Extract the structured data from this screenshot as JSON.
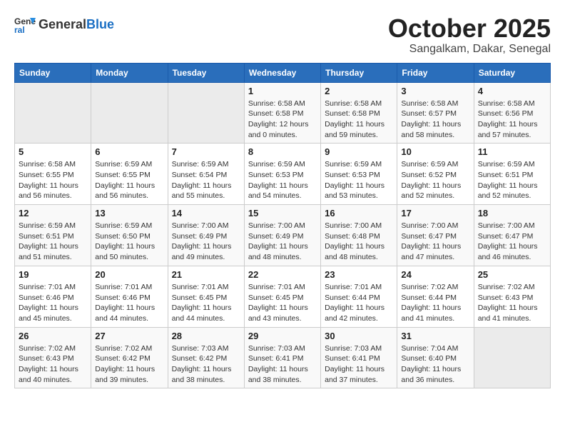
{
  "header": {
    "logo_line1": "General",
    "logo_line2": "Blue",
    "month": "October 2025",
    "location": "Sangalkam, Dakar, Senegal"
  },
  "weekdays": [
    "Sunday",
    "Monday",
    "Tuesday",
    "Wednesday",
    "Thursday",
    "Friday",
    "Saturday"
  ],
  "weeks": [
    [
      {
        "day": "",
        "info": ""
      },
      {
        "day": "",
        "info": ""
      },
      {
        "day": "",
        "info": ""
      },
      {
        "day": "1",
        "info": "Sunrise: 6:58 AM\nSunset: 6:58 PM\nDaylight: 12 hours\nand 0 minutes."
      },
      {
        "day": "2",
        "info": "Sunrise: 6:58 AM\nSunset: 6:58 PM\nDaylight: 11 hours\nand 59 minutes."
      },
      {
        "day": "3",
        "info": "Sunrise: 6:58 AM\nSunset: 6:57 PM\nDaylight: 11 hours\nand 58 minutes."
      },
      {
        "day": "4",
        "info": "Sunrise: 6:58 AM\nSunset: 6:56 PM\nDaylight: 11 hours\nand 57 minutes."
      }
    ],
    [
      {
        "day": "5",
        "info": "Sunrise: 6:58 AM\nSunset: 6:55 PM\nDaylight: 11 hours\nand 56 minutes."
      },
      {
        "day": "6",
        "info": "Sunrise: 6:59 AM\nSunset: 6:55 PM\nDaylight: 11 hours\nand 56 minutes."
      },
      {
        "day": "7",
        "info": "Sunrise: 6:59 AM\nSunset: 6:54 PM\nDaylight: 11 hours\nand 55 minutes."
      },
      {
        "day": "8",
        "info": "Sunrise: 6:59 AM\nSunset: 6:53 PM\nDaylight: 11 hours\nand 54 minutes."
      },
      {
        "day": "9",
        "info": "Sunrise: 6:59 AM\nSunset: 6:53 PM\nDaylight: 11 hours\nand 53 minutes."
      },
      {
        "day": "10",
        "info": "Sunrise: 6:59 AM\nSunset: 6:52 PM\nDaylight: 11 hours\nand 52 minutes."
      },
      {
        "day": "11",
        "info": "Sunrise: 6:59 AM\nSunset: 6:51 PM\nDaylight: 11 hours\nand 52 minutes."
      }
    ],
    [
      {
        "day": "12",
        "info": "Sunrise: 6:59 AM\nSunset: 6:51 PM\nDaylight: 11 hours\nand 51 minutes."
      },
      {
        "day": "13",
        "info": "Sunrise: 6:59 AM\nSunset: 6:50 PM\nDaylight: 11 hours\nand 50 minutes."
      },
      {
        "day": "14",
        "info": "Sunrise: 7:00 AM\nSunset: 6:49 PM\nDaylight: 11 hours\nand 49 minutes."
      },
      {
        "day": "15",
        "info": "Sunrise: 7:00 AM\nSunset: 6:49 PM\nDaylight: 11 hours\nand 48 minutes."
      },
      {
        "day": "16",
        "info": "Sunrise: 7:00 AM\nSunset: 6:48 PM\nDaylight: 11 hours\nand 48 minutes."
      },
      {
        "day": "17",
        "info": "Sunrise: 7:00 AM\nSunset: 6:47 PM\nDaylight: 11 hours\nand 47 minutes."
      },
      {
        "day": "18",
        "info": "Sunrise: 7:00 AM\nSunset: 6:47 PM\nDaylight: 11 hours\nand 46 minutes."
      }
    ],
    [
      {
        "day": "19",
        "info": "Sunrise: 7:01 AM\nSunset: 6:46 PM\nDaylight: 11 hours\nand 45 minutes."
      },
      {
        "day": "20",
        "info": "Sunrise: 7:01 AM\nSunset: 6:46 PM\nDaylight: 11 hours\nand 44 minutes."
      },
      {
        "day": "21",
        "info": "Sunrise: 7:01 AM\nSunset: 6:45 PM\nDaylight: 11 hours\nand 44 minutes."
      },
      {
        "day": "22",
        "info": "Sunrise: 7:01 AM\nSunset: 6:45 PM\nDaylight: 11 hours\nand 43 minutes."
      },
      {
        "day": "23",
        "info": "Sunrise: 7:01 AM\nSunset: 6:44 PM\nDaylight: 11 hours\nand 42 minutes."
      },
      {
        "day": "24",
        "info": "Sunrise: 7:02 AM\nSunset: 6:44 PM\nDaylight: 11 hours\nand 41 minutes."
      },
      {
        "day": "25",
        "info": "Sunrise: 7:02 AM\nSunset: 6:43 PM\nDaylight: 11 hours\nand 41 minutes."
      }
    ],
    [
      {
        "day": "26",
        "info": "Sunrise: 7:02 AM\nSunset: 6:43 PM\nDaylight: 11 hours\nand 40 minutes."
      },
      {
        "day": "27",
        "info": "Sunrise: 7:02 AM\nSunset: 6:42 PM\nDaylight: 11 hours\nand 39 minutes."
      },
      {
        "day": "28",
        "info": "Sunrise: 7:03 AM\nSunset: 6:42 PM\nDaylight: 11 hours\nand 38 minutes."
      },
      {
        "day": "29",
        "info": "Sunrise: 7:03 AM\nSunset: 6:41 PM\nDaylight: 11 hours\nand 38 minutes."
      },
      {
        "day": "30",
        "info": "Sunrise: 7:03 AM\nSunset: 6:41 PM\nDaylight: 11 hours\nand 37 minutes."
      },
      {
        "day": "31",
        "info": "Sunrise: 7:04 AM\nSunset: 6:40 PM\nDaylight: 11 hours\nand 36 minutes."
      },
      {
        "day": "",
        "info": ""
      }
    ]
  ]
}
